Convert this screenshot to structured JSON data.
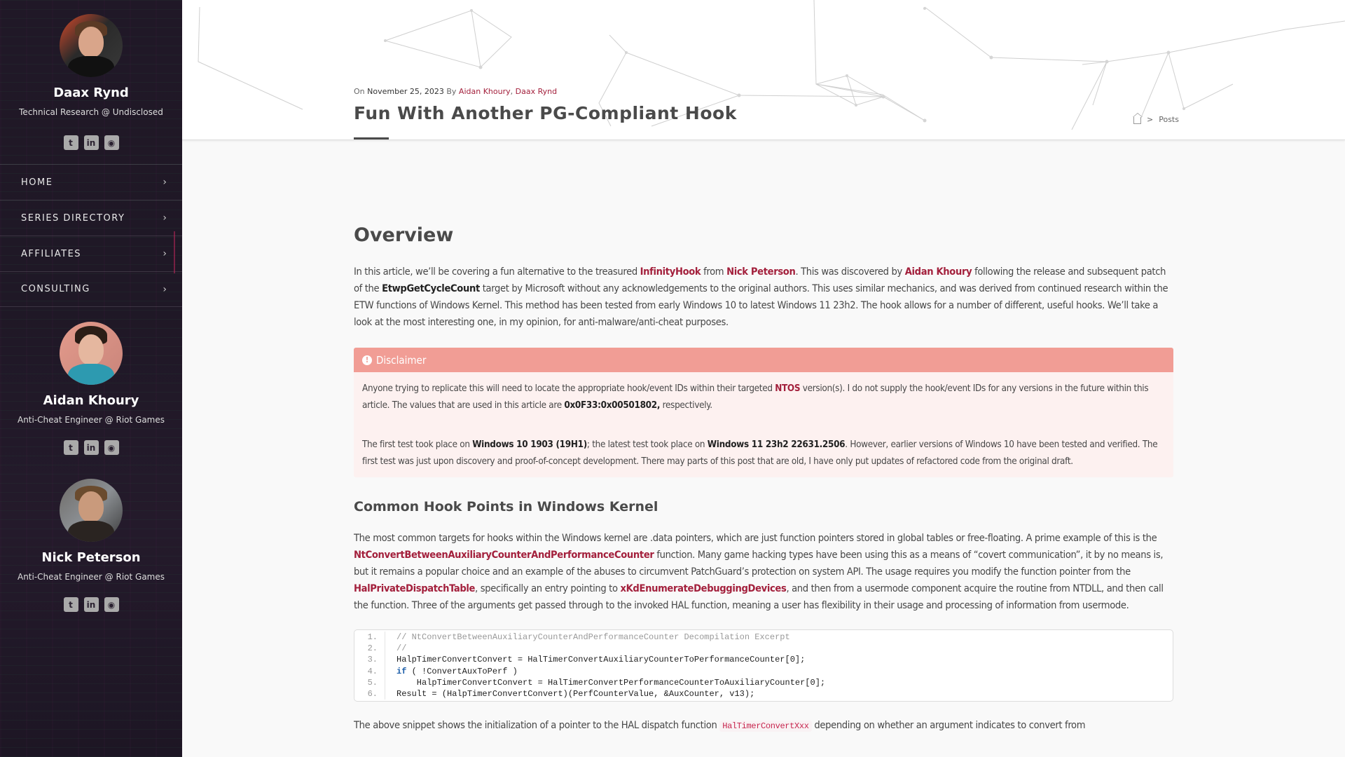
{
  "sidebar": {
    "profiles": [
      {
        "name": "Daax Rynd",
        "role": "Technical Research @ Undisclosed",
        "socials": [
          "twitter-icon",
          "linkedin-icon",
          "github-icon"
        ]
      },
      {
        "name": "Aidan Khoury",
        "role": "Anti-Cheat Engineer @ Riot Games",
        "socials": [
          "twitter-icon",
          "linkedin-icon",
          "github-icon"
        ]
      },
      {
        "name": "Nick Peterson",
        "role": "Anti-Cheat Engineer @ Riot Games",
        "socials": [
          "twitter-icon",
          "linkedin-icon",
          "github-icon"
        ]
      }
    ],
    "social_glyphs": {
      "twitter": "t",
      "linkedin": "in",
      "github": "◉"
    },
    "nav": [
      {
        "label": "HOME"
      },
      {
        "label": "SERIES DIRECTORY"
      },
      {
        "label": "AFFILIATES"
      },
      {
        "label": "CONSULTING"
      }
    ],
    "chevron": "›"
  },
  "header": {
    "on_label": "On",
    "date": "November 25, 2023",
    "by_label": "By",
    "authors": [
      "Aidan Khoury",
      "Daax Rynd"
    ],
    "title": "Fun With Another PG-Compliant Hook",
    "breadcrumb": {
      "current": "Posts",
      "separator": ">"
    }
  },
  "article": {
    "overview_heading": "Overview",
    "intro": {
      "t1": "In this article, we’ll be covering a fun alternative to the treasured ",
      "l1": "InfinityHook",
      "t2": " from ",
      "l2": "Nick Peterson",
      "t3": ". This was discovered by ",
      "l3": "Aidan Khoury",
      "t4": " following the release and subsequent patch of the ",
      "b1": "EtwpGetCycleCount",
      "t5": " target by Microsoft without any acknowledgements to the original authors. This uses similar mechanics, and was derived from continued research within the ETW functions of Windows Kernel. This method has been tested from early Windows 10 to latest Windows 11 23h2. The hook allows for a number of different, useful hooks. We’ll take a look at the most interesting one, in my opinion, for anti-malware/anti-cheat purposes."
    },
    "disclaimer": {
      "title": "Disclaimer",
      "p1": {
        "t1": "Anyone trying to replicate this will need to locate the appropriate hook/event IDs within their targeted ",
        "l1": "NTOS",
        "t2": " version(s). I do not supply the hook/event IDs for any versions in the future within this article. The values that are used in this article are ",
        "b1": "0x0F33:0x00501802,",
        "t3": " respectively."
      },
      "p2": {
        "t1": "The first test took place on ",
        "b1": "Windows 10 1903 (19H1)",
        "t2": "; the latest test took place on ",
        "b2": "Windows 11 23h2 22631.2506",
        "t3": ". However, earlier versions of Windows 10 have been tested and verified. The first test was just upon discovery and proof-of-concept development. There may parts of this post that are old, I have only put updates of refactored code from the original draft."
      }
    },
    "hook_heading": "Common Hook Points in Windows Kernel",
    "hook_para": {
      "t1": "The most common targets for hooks within the Windows kernel are .data pointers, which are just function pointers stored in global tables or free-floating. A prime example of this is the ",
      "l1": "NtConvertBetweenAuxiliaryCounterAndPerformanceCounter",
      "t2": " function. Many game hacking types have been using this as a means of “covert communication”, it by no means is, but it remains a popular choice and an example of the abuses to circumvent PatchGuard’s protection on system API. The usage requires you modify the function pointer from the ",
      "l2": "HalPrivateDispatchTable",
      "t3": ", specifically an entry pointing to ",
      "l3": "xKdEnumerateDebuggingDevices",
      "t4": ", and then from a usermode component acquire the routine from NTDLL, and then call the function. Three of the arguments get passed through to the invoked HAL function, meaning a user has flexibility in their usage and processing of information from usermode."
    },
    "code": [
      {
        "n": "1.",
        "text": "// NtConvertBetweenAuxiliaryCounterAndPerformanceCounter Decompilation Excerpt"
      },
      {
        "n": "2.",
        "text": "//"
      },
      {
        "n": "3.",
        "text": "HalpTimerConvertConvert = HalTimerConvertAuxiliaryCounterToPerformanceCounter[0];"
      },
      {
        "n": "4.",
        "kw": "if",
        "text": " ( !ConvertAuxToPerf )"
      },
      {
        "n": "5.",
        "text": "    HalpTimerConvertConvert = HalTimerConvertPerformanceCounterToAuxiliaryCounter[0];"
      },
      {
        "n": "6.",
        "text": "Result = (HalpTimerConvertConvert)(PerfCounterValue, &AuxCounter, v13);"
      }
    ],
    "tail": {
      "t1": "The above snippet shows the initialization of a pointer to the HAL dispatch function ",
      "c1": "HalTimerConvertXxx",
      "t2": " depending on whether an argument indicates to convert from"
    }
  },
  "colors": {
    "accent": "#a3203c",
    "disclaimer": "#f19d95",
    "sidebar_bg": "#201827"
  }
}
